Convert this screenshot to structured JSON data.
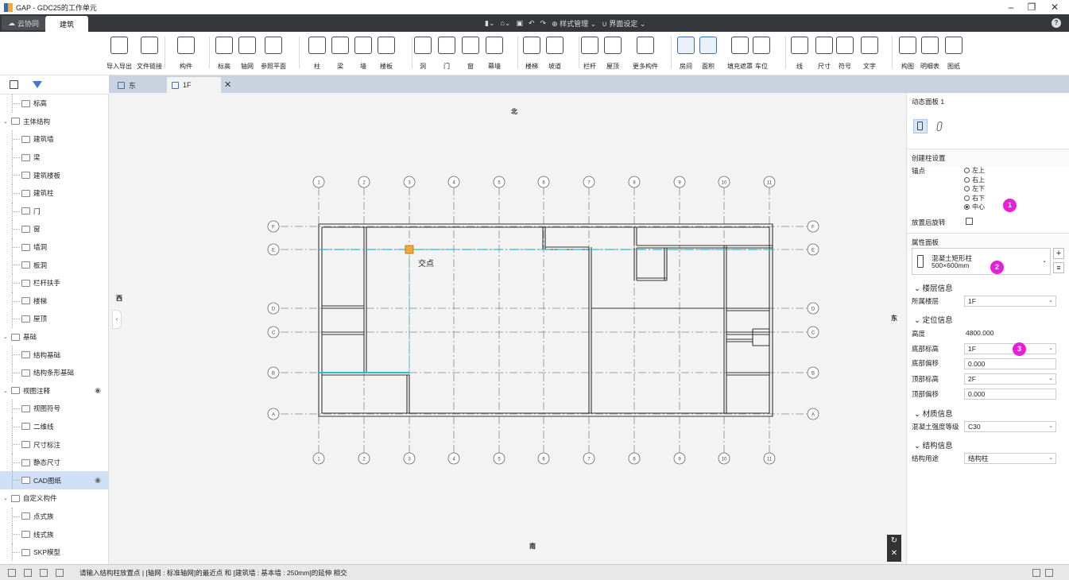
{
  "titlebar": {
    "title": "GAP - GDC25的工作单元",
    "minimize": "–",
    "restore": "❐",
    "close": "✕"
  },
  "menubar": {
    "tabs": [
      {
        "label": "云协同"
      },
      {
        "label": "建筑"
      }
    ],
    "quick": {
      "style_manage": "样式管理",
      "ui_settings": "界面设定"
    }
  },
  "ribbon": {
    "buttons": [
      {
        "label": "导入导出",
        "icon": "cad-import-icon"
      },
      {
        "label": "文件链接",
        "icon": "file-link-icon"
      },
      {
        "label": "构件",
        "icon": "component-icon"
      },
      {
        "label": "标高",
        "icon": "level-icon"
      },
      {
        "label": "轴网",
        "icon": "grid-icon"
      },
      {
        "label": "参照平面",
        "icon": "ref-plane-icon"
      },
      {
        "label": "柱",
        "icon": "column-icon"
      },
      {
        "label": "梁",
        "icon": "beam-icon"
      },
      {
        "label": "墙",
        "icon": "wall-icon"
      },
      {
        "label": "楼板",
        "icon": "slab-icon"
      },
      {
        "label": "洞",
        "icon": "hole-icon"
      },
      {
        "label": "门",
        "icon": "door-icon"
      },
      {
        "label": "窗",
        "icon": "window-icon"
      },
      {
        "label": "幕墙",
        "icon": "curtain-wall-icon"
      },
      {
        "label": "楼梯",
        "icon": "stair-icon"
      },
      {
        "label": "坡道",
        "icon": "ramp-icon"
      },
      {
        "label": "栏杆",
        "icon": "railing-icon"
      },
      {
        "label": "屋顶",
        "icon": "roof-icon"
      },
      {
        "label": "更多构件",
        "icon": "more-components-icon"
      },
      {
        "label": "房间",
        "icon": "room-icon"
      },
      {
        "label": "面积",
        "icon": "area-icon"
      },
      {
        "label": "填充遮罩",
        "icon": "fill-mask-icon"
      },
      {
        "label": "车位",
        "icon": "parking-icon"
      },
      {
        "label": "线",
        "icon": "line-icon"
      },
      {
        "label": "尺寸",
        "icon": "dimension-icon"
      },
      {
        "label": "符号",
        "icon": "symbol-icon"
      },
      {
        "label": "文字",
        "icon": "text-icon"
      },
      {
        "label": "构图",
        "icon": "drawing-icon"
      },
      {
        "label": "明细表",
        "icon": "schedule-icon"
      },
      {
        "label": "图纸",
        "icon": "sheet-icon"
      }
    ]
  },
  "tree": {
    "items": [
      {
        "label": "标高",
        "level": 1
      },
      {
        "label": "主体结构",
        "level": 0
      },
      {
        "label": "建筑墙",
        "level": 1
      },
      {
        "label": "梁",
        "level": 1
      },
      {
        "label": "建筑楼板",
        "level": 1
      },
      {
        "label": "建筑柱",
        "level": 1
      },
      {
        "label": "门",
        "level": 1
      },
      {
        "label": "窗",
        "level": 1
      },
      {
        "label": "墙洞",
        "level": 1
      },
      {
        "label": "板洞",
        "level": 1
      },
      {
        "label": "栏杆扶手",
        "level": 1
      },
      {
        "label": "楼梯",
        "level": 1
      },
      {
        "label": "屋顶",
        "level": 1
      },
      {
        "label": "基础",
        "level": 0
      },
      {
        "label": "结构基础",
        "level": 1
      },
      {
        "label": "结构条形基础",
        "level": 1
      },
      {
        "label": "视图注释",
        "level": 0
      },
      {
        "label": "视图符号",
        "level": 1
      },
      {
        "label": "二维线",
        "level": 1
      },
      {
        "label": "尺寸标注",
        "level": 1
      },
      {
        "label": "静态尺寸",
        "level": 1
      },
      {
        "label": "CAD图纸",
        "level": 1
      },
      {
        "label": "自定义构件",
        "level": 0
      },
      {
        "label": "点式族",
        "level": 1
      },
      {
        "label": "线式族",
        "level": 1
      },
      {
        "label": "SKP模型",
        "level": 1
      }
    ]
  },
  "doc_tabs": [
    {
      "label": "东"
    },
    {
      "label": "1F"
    }
  ],
  "tab_close": "✕",
  "canvas": {
    "compass": {
      "north": "北",
      "south": "南",
      "west": "西",
      "east": "东"
    },
    "snap_label": "交点",
    "grid_cols": [
      "1",
      "2",
      "3",
      "4",
      "5",
      "6",
      "7",
      "8",
      "9",
      "10",
      "11"
    ],
    "grid_rows": [
      "F",
      "E",
      "D",
      "C",
      "B",
      "A"
    ]
  },
  "props": {
    "dynamic_panel": "动态面板 1",
    "create_settings": "创建柱设置",
    "anchor_label": "锚点",
    "anchors": [
      "左上",
      "右上",
      "左下",
      "右下",
      "中心"
    ],
    "rotate_label": "放置后旋转",
    "attr_panel": "属性面板",
    "type_name": "混凝土矩形柱",
    "type_size": "500×600mm",
    "floor_info": "楼层信息",
    "floor_label": "所属楼层",
    "floor_value": "1F",
    "pos_info": "定位信息",
    "height_label": "高度",
    "height_value": "4800.000",
    "bottom_level_label": "底部标高",
    "bottom_level_value": "1F",
    "bottom_offset_label": "底部偏移",
    "bottom_offset_value": "0.000",
    "top_level_label": "顶部标高",
    "top_level_value": "2F",
    "top_offset_label": "顶部偏移",
    "top_offset_value": "0.000",
    "material_info": "材质信息",
    "grade_label": "混凝土强度等级",
    "grade_value": "C30",
    "struct_info": "结构信息",
    "usage_label": "结构用途",
    "usage_value": "结构柱",
    "badges": [
      "1",
      "2",
      "3"
    ]
  },
  "status": {
    "text": "请输入结构柱放置点 | [轴网 : 标准轴网]的最近点 和 [建筑墙 : 基本墙 : 250mm]的延伸 相交"
  },
  "colors": {
    "accent": "#3b78d8",
    "badge": "#e81edb",
    "cyan": "#19c3d8",
    "menubar": "#35373a"
  }
}
